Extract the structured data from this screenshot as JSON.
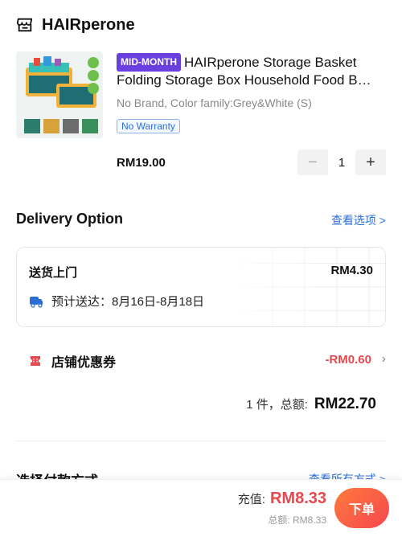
{
  "store": {
    "name": "HAIRperone",
    "icon": "store-icon"
  },
  "product": {
    "badge": "MID-MONTH",
    "title": "HAIRperone Storage Basket Folding Storage Box Household Food B…",
    "variant": "No Brand, Color family:Grey&White (S)",
    "warranty": "No Warranty",
    "price": "RM19.00",
    "quantity": "1",
    "minus_label": "−",
    "plus_label": "+"
  },
  "delivery": {
    "title": "Delivery Option",
    "link": "查看选项 >",
    "method": "送货上门",
    "price": "RM4.30",
    "eta": "预计送达：8月16日-8月18日"
  },
  "voucher": {
    "label": "店铺优惠券",
    "value": "-RM0.60",
    "chevron": "›"
  },
  "summary": {
    "count": "1 件，总额:",
    "total": "RM22.70"
  },
  "payment": {
    "title": "选择付款方式",
    "link": "查看所有方式 >"
  },
  "footer": {
    "pay_label": "充值:",
    "pay_amount": "RM8.33",
    "total_text": "总额: RM8.33",
    "order_button": "下单"
  },
  "colors": {
    "accent_blue": "#2b6fd6",
    "price_red": "#e5484d",
    "badge_purple": "#6a3fe0",
    "order_button": "#f5474f"
  }
}
